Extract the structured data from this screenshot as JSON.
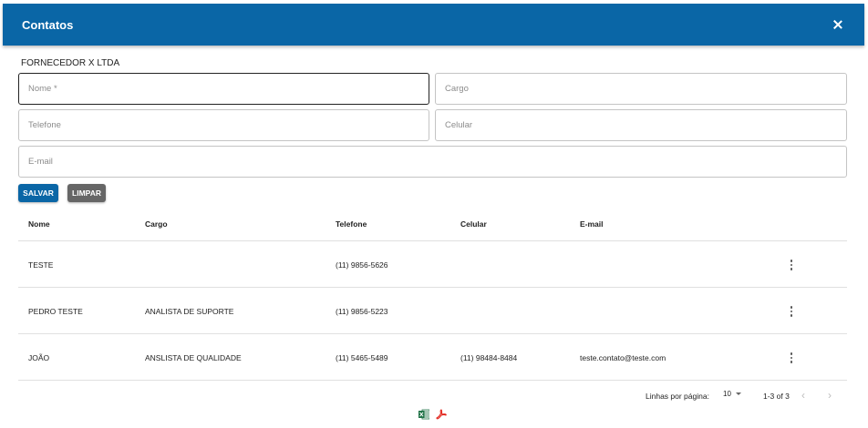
{
  "dialog": {
    "title": "Contatos",
    "supplier": "FORNECEDOR X LTDA"
  },
  "form": {
    "name_placeholder": "Nome *",
    "role_placeholder": "Cargo",
    "phone_placeholder": "Telefone",
    "mobile_placeholder": "Celular",
    "email_placeholder": "E-mail",
    "save_label": "SALVAR",
    "clear_label": "LIMPAR"
  },
  "table": {
    "columns": [
      "Nome",
      "Cargo",
      "Telefone",
      "Celular",
      "E-mail"
    ],
    "rows": [
      [
        "TESTE",
        "",
        "(11) 9856-5626",
        "",
        ""
      ],
      [
        "PEDRO TESTE",
        "ANALISTA DE SUPORTE",
        "(11) 9856-5223",
        "",
        ""
      ],
      [
        "JOÃO",
        "ANSLISTA DE QUALIDADE",
        "(11) 5465-5489",
        "(11) 98484-8484",
        "teste.contato@teste.com"
      ]
    ]
  },
  "pagination": {
    "rows_label": "Linhas por página:",
    "rows_per_page": "10",
    "range": "1-3 of 3"
  },
  "icons": {
    "close": "close-icon",
    "row_menu": "more-vert-icon",
    "excel": "excel-icon",
    "pdf": "pdf-icon"
  },
  "colors": {
    "primary": "#0a66a6",
    "secondary_button": "#666666",
    "excel_green": "#1e7145",
    "pdf_red": "#e2231a"
  }
}
